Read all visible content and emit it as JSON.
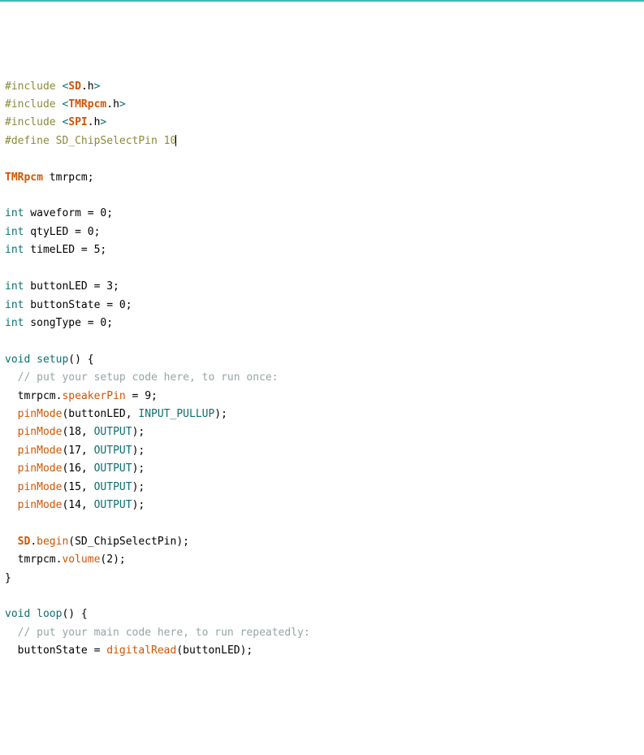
{
  "code": {
    "lines": [
      {
        "segments": [
          {
            "cls": "preproc",
            "t": "#include "
          },
          {
            "cls": "angle",
            "t": "<"
          },
          {
            "cls": "classname",
            "t": "SD"
          },
          {
            "cls": "punct",
            "t": ".h"
          },
          {
            "cls": "angle",
            "t": ">"
          }
        ]
      },
      {
        "segments": [
          {
            "cls": "preproc",
            "t": "#include "
          },
          {
            "cls": "angle",
            "t": "<"
          },
          {
            "cls": "classname",
            "t": "TMRpcm"
          },
          {
            "cls": "punct",
            "t": ".h"
          },
          {
            "cls": "angle",
            "t": ">"
          }
        ]
      },
      {
        "segments": [
          {
            "cls": "preproc",
            "t": "#include "
          },
          {
            "cls": "angle",
            "t": "<"
          },
          {
            "cls": "classname",
            "t": "SPI"
          },
          {
            "cls": "punct",
            "t": ".h"
          },
          {
            "cls": "angle",
            "t": ">"
          }
        ]
      },
      {
        "segments": [
          {
            "cls": "preproc",
            "t": "#define SD_ChipSelectPin 10"
          }
        ],
        "cursor": true
      },
      {
        "segments": [
          {
            "cls": "",
            "t": ""
          }
        ]
      },
      {
        "segments": [
          {
            "cls": "classname",
            "t": "TMRpcm"
          },
          {
            "cls": "ident",
            "t": " tmrpcm;"
          }
        ]
      },
      {
        "segments": [
          {
            "cls": "",
            "t": ""
          }
        ]
      },
      {
        "segments": [
          {
            "cls": "type",
            "t": "int"
          },
          {
            "cls": "ident",
            "t": " waveform = 0;"
          }
        ]
      },
      {
        "segments": [
          {
            "cls": "type",
            "t": "int"
          },
          {
            "cls": "ident",
            "t": " qtyLED = 0;"
          }
        ]
      },
      {
        "segments": [
          {
            "cls": "type",
            "t": "int"
          },
          {
            "cls": "ident",
            "t": " timeLED = 5;"
          }
        ]
      },
      {
        "segments": [
          {
            "cls": "",
            "t": ""
          }
        ]
      },
      {
        "segments": [
          {
            "cls": "type",
            "t": "int"
          },
          {
            "cls": "ident",
            "t": " buttonLED = 3;"
          }
        ]
      },
      {
        "segments": [
          {
            "cls": "type",
            "t": "int"
          },
          {
            "cls": "ident",
            "t": " buttonState = 0;"
          }
        ]
      },
      {
        "segments": [
          {
            "cls": "type",
            "t": "int"
          },
          {
            "cls": "ident",
            "t": " songType = 0;"
          }
        ]
      },
      {
        "segments": [
          {
            "cls": "",
            "t": ""
          }
        ]
      },
      {
        "segments": [
          {
            "cls": "type",
            "t": "void"
          },
          {
            "cls": "ident",
            "t": " "
          },
          {
            "cls": "keyword",
            "t": "setup"
          },
          {
            "cls": "ident",
            "t": "() {"
          }
        ]
      },
      {
        "segments": [
          {
            "cls": "ident",
            "t": "  "
          },
          {
            "cls": "comment",
            "t": "// put your setup code here, to run once:"
          }
        ]
      },
      {
        "segments": [
          {
            "cls": "ident",
            "t": "  tmrpcm."
          },
          {
            "cls": "func",
            "t": "speakerPin"
          },
          {
            "cls": "ident",
            "t": " = 9;"
          }
        ]
      },
      {
        "segments": [
          {
            "cls": "ident",
            "t": "  "
          },
          {
            "cls": "func",
            "t": "pinMode"
          },
          {
            "cls": "ident",
            "t": "(buttonLED, "
          },
          {
            "cls": "const",
            "t": "INPUT_PULLUP"
          },
          {
            "cls": "ident",
            "t": ");"
          }
        ]
      },
      {
        "segments": [
          {
            "cls": "ident",
            "t": "  "
          },
          {
            "cls": "func",
            "t": "pinMode"
          },
          {
            "cls": "ident",
            "t": "(18, "
          },
          {
            "cls": "const",
            "t": "OUTPUT"
          },
          {
            "cls": "ident",
            "t": ");"
          }
        ]
      },
      {
        "segments": [
          {
            "cls": "ident",
            "t": "  "
          },
          {
            "cls": "func",
            "t": "pinMode"
          },
          {
            "cls": "ident",
            "t": "(17, "
          },
          {
            "cls": "const",
            "t": "OUTPUT"
          },
          {
            "cls": "ident",
            "t": ");"
          }
        ]
      },
      {
        "segments": [
          {
            "cls": "ident",
            "t": "  "
          },
          {
            "cls": "func",
            "t": "pinMode"
          },
          {
            "cls": "ident",
            "t": "(16, "
          },
          {
            "cls": "const",
            "t": "OUTPUT"
          },
          {
            "cls": "ident",
            "t": ");"
          }
        ]
      },
      {
        "segments": [
          {
            "cls": "ident",
            "t": "  "
          },
          {
            "cls": "func",
            "t": "pinMode"
          },
          {
            "cls": "ident",
            "t": "(15, "
          },
          {
            "cls": "const",
            "t": "OUTPUT"
          },
          {
            "cls": "ident",
            "t": ");"
          }
        ]
      },
      {
        "segments": [
          {
            "cls": "ident",
            "t": "  "
          },
          {
            "cls": "func",
            "t": "pinMode"
          },
          {
            "cls": "ident",
            "t": "(14, "
          },
          {
            "cls": "const",
            "t": "OUTPUT"
          },
          {
            "cls": "ident",
            "t": ");"
          }
        ]
      },
      {
        "segments": [
          {
            "cls": "",
            "t": ""
          }
        ]
      },
      {
        "segments": [
          {
            "cls": "ident",
            "t": "  "
          },
          {
            "cls": "classname",
            "t": "SD"
          },
          {
            "cls": "ident",
            "t": "."
          },
          {
            "cls": "func",
            "t": "begin"
          },
          {
            "cls": "ident",
            "t": "(SD_ChipSelectPin);"
          }
        ]
      },
      {
        "segments": [
          {
            "cls": "ident",
            "t": "  tmrpcm."
          },
          {
            "cls": "func",
            "t": "volume"
          },
          {
            "cls": "ident",
            "t": "(2);"
          }
        ]
      },
      {
        "segments": [
          {
            "cls": "ident",
            "t": "}"
          }
        ]
      },
      {
        "segments": [
          {
            "cls": "",
            "t": ""
          }
        ]
      },
      {
        "segments": [
          {
            "cls": "type",
            "t": "void"
          },
          {
            "cls": "ident",
            "t": " "
          },
          {
            "cls": "keyword",
            "t": "loop"
          },
          {
            "cls": "ident",
            "t": "() {"
          }
        ]
      },
      {
        "segments": [
          {
            "cls": "ident",
            "t": "  "
          },
          {
            "cls": "comment",
            "t": "// put your main code here, to run repeatedly:"
          }
        ]
      },
      {
        "segments": [
          {
            "cls": "ident",
            "t": "  buttonState = "
          },
          {
            "cls": "func",
            "t": "digitalRead"
          },
          {
            "cls": "ident",
            "t": "(buttonLED);"
          }
        ]
      }
    ]
  }
}
